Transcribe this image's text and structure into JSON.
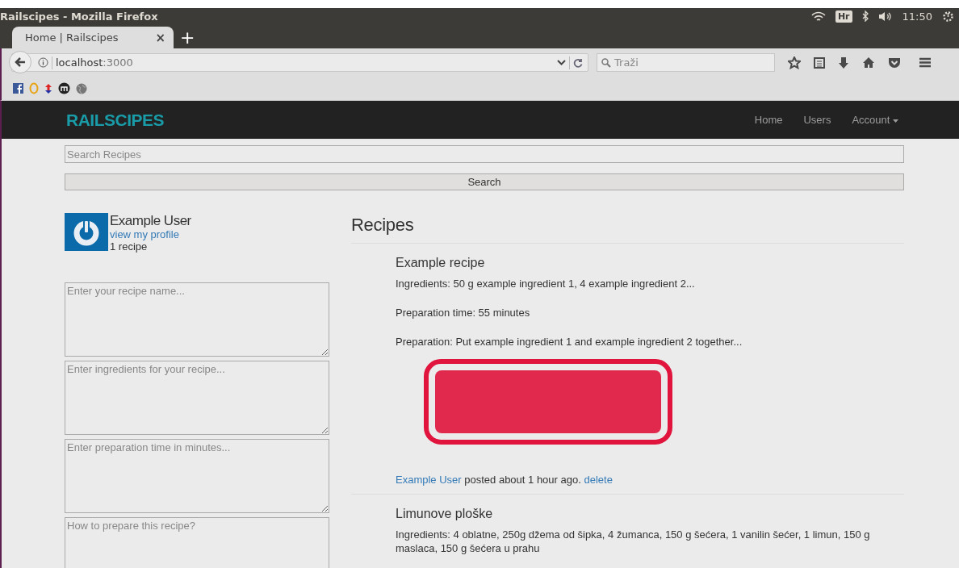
{
  "os_bar": {
    "window_title": "Railscipes - Mozilla Firefox",
    "keyboard_layout": "Hr",
    "clock": "11:50"
  },
  "browser": {
    "tabs": [
      {
        "label": "Home | Railscipes",
        "selected": true,
        "close": "×"
      }
    ],
    "new_tab": "+",
    "url_host": "localhost",
    "url_port": ":3000",
    "search_placeholder": "Traži"
  },
  "navbar": {
    "brand": "RAILSCIPES",
    "links": [
      {
        "label": "Home",
        "kind": "link"
      },
      {
        "label": "Users",
        "kind": "link"
      },
      {
        "label": "Account",
        "kind": "dropdown"
      }
    ]
  },
  "search": {
    "placeholder": "Search Recipes",
    "button": "Search"
  },
  "user": {
    "name": "Example User",
    "profile_link": "view my profile",
    "recipe_count": "1 recipe"
  },
  "form_fields": [
    {
      "placeholder": "Enter your recipe name..."
    },
    {
      "placeholder": "Enter ingredients for your recipe..."
    },
    {
      "placeholder": "Enter preparation time in minutes..."
    },
    {
      "placeholder": "How to prepare this recipe?"
    }
  ],
  "recipes_heading": "Recipes",
  "recipes": [
    {
      "title": "Example recipe",
      "ingredients": "Ingredients: 50 g example ingredient 1, 4 example ingredient 2...",
      "prep_time": "Preparation time: 55 minutes",
      "preparation": "Preparation: Put example ingredient 1 and example ingredient 2 together...",
      "has_image": true,
      "author": "Example User",
      "posted": "posted about 1 hour ago.",
      "delete": "delete"
    },
    {
      "title": "Limunove ploške",
      "ingredients": "Ingredients: 4 oblatne, 250g džema od šipka, 4 žumanca, 150 g šećera, 1 vanilin šećer, 1 limun, 150 g maslaca, 150 g šećera u prahu"
    }
  ]
}
